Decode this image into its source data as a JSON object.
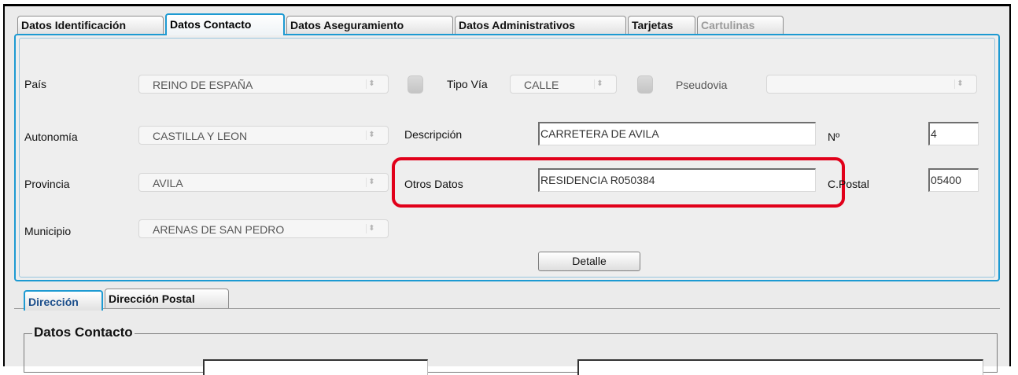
{
  "tabs": [
    {
      "label": "Datos Identificación",
      "state": "normal"
    },
    {
      "label": "Datos Contacto",
      "state": "active"
    },
    {
      "label": "Datos Aseguramiento",
      "state": "normal"
    },
    {
      "label": "Datos Administrativos",
      "state": "normal"
    },
    {
      "label": "Tarjetas",
      "state": "normal"
    },
    {
      "label": "Cartulinas",
      "state": "disabled"
    }
  ],
  "form": {
    "pais": {
      "label": "País",
      "value": "REINO DE ESPAÑA"
    },
    "tipo_via": {
      "label": "Tipo Vía",
      "value": "CALLE"
    },
    "pseudovia": {
      "label": "Pseudovia",
      "value": ""
    },
    "autonomia": {
      "label": "Autonomía",
      "value": "CASTILLA Y LEON"
    },
    "descripcion": {
      "label": "Descripción",
      "value": "CARRETERA DE AVILA"
    },
    "numero": {
      "label": "Nº",
      "value": "4"
    },
    "provincia": {
      "label": "Provincia",
      "value": "AVILA"
    },
    "otros_datos": {
      "label": "Otros Datos",
      "value": "RESIDENCIA R050384"
    },
    "cpostal": {
      "label": "C.Postal",
      "value": "05400"
    },
    "municipio": {
      "label": "Municipio",
      "value": "ARENAS DE SAN PEDRO"
    },
    "detalle_button": "Detalle"
  },
  "subtabs": [
    {
      "label": "Dirección",
      "state": "active"
    },
    {
      "label": "Dirección Postal",
      "state": "normal"
    }
  ],
  "section": {
    "title": "Datos Contacto"
  },
  "colors": {
    "accent": "#1d9ad2",
    "highlight": "#e1001a",
    "background": "#ebebeb"
  },
  "icons": {
    "combo_arrow": "updown-arrows-icon",
    "lookup": "lookup-button-icon"
  }
}
